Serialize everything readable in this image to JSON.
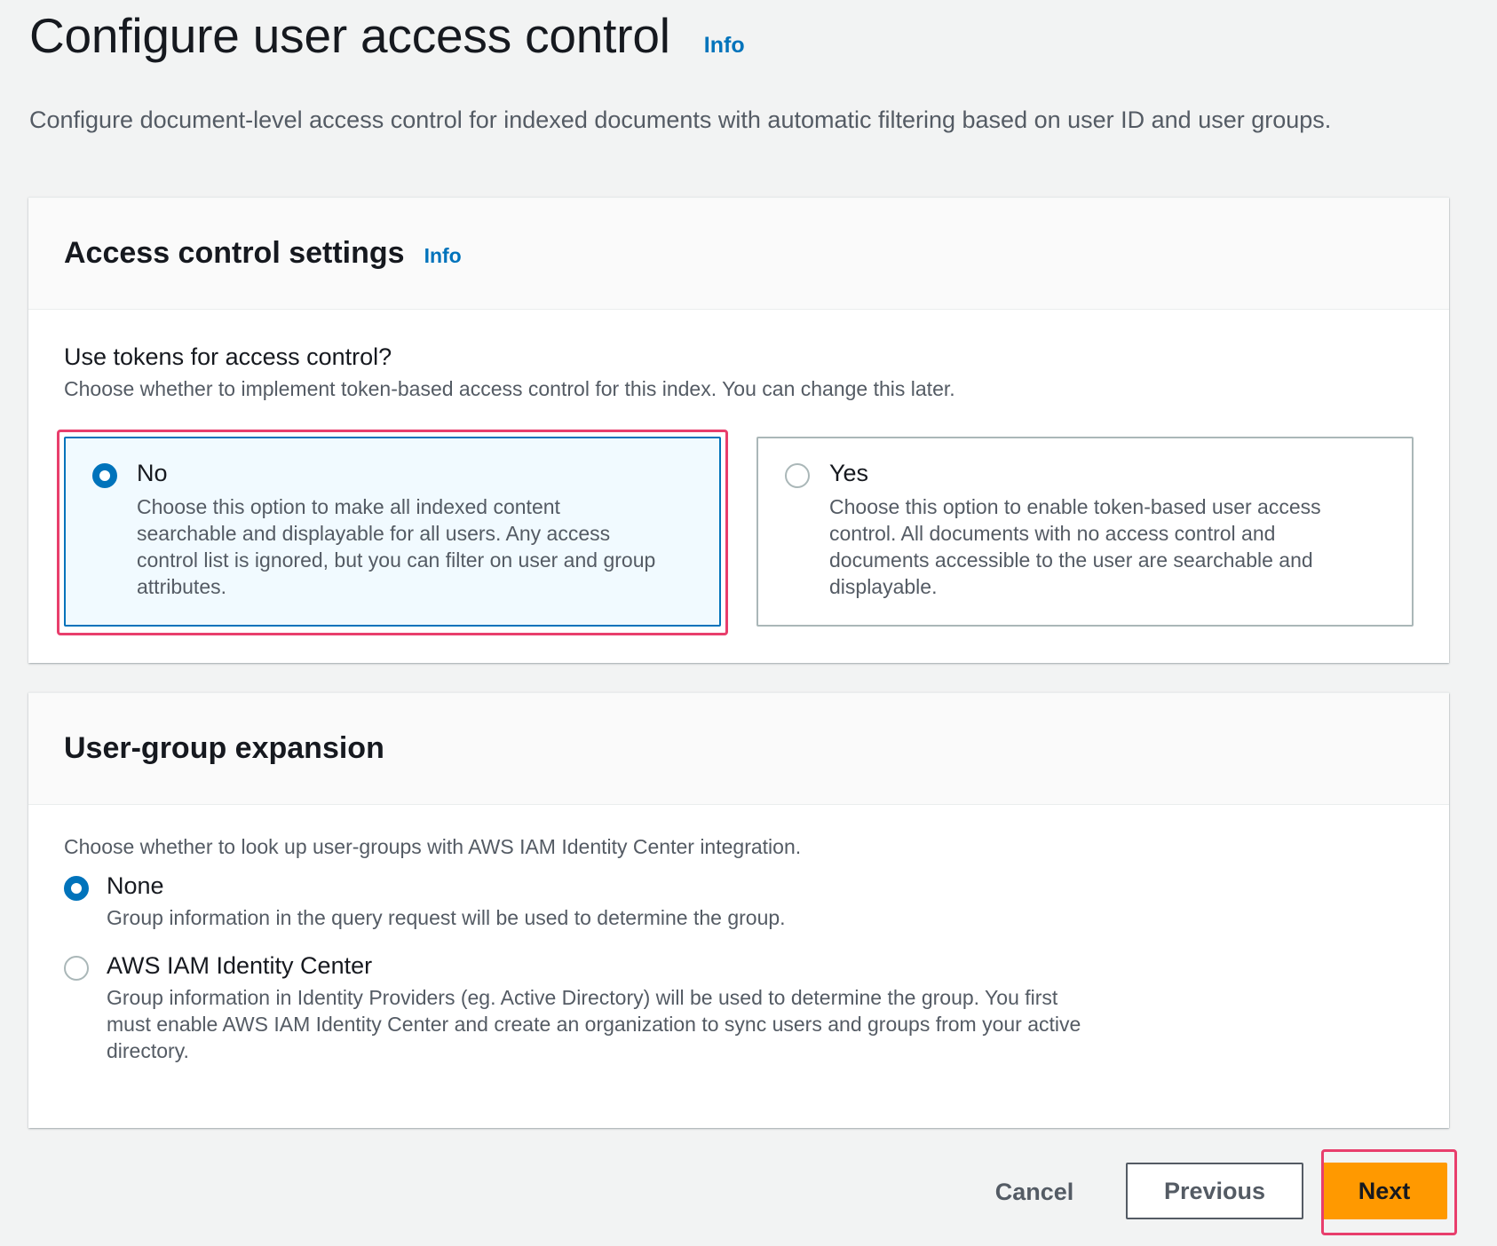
{
  "header": {
    "title": "Configure user access control",
    "info_label": "Info",
    "description": "Configure document-level access control for indexed documents with automatic filtering based on user ID and user groups."
  },
  "access_control": {
    "title": "Access control settings",
    "info_label": "Info",
    "field_label": "Use tokens for access control?",
    "field_description": "Choose whether to implement token-based access control for this index. You can change this later.",
    "selected": "no",
    "options": [
      {
        "id": "no",
        "label": "No",
        "description": "Choose this option to make all indexed content searchable and displayable for all users. Any access control list is ignored, but you can filter on user and group attributes."
      },
      {
        "id": "yes",
        "label": "Yes",
        "description": "Choose this option to enable token-based user access control. All documents with no access control and documents accessible to the user are searchable and displayable."
      }
    ]
  },
  "user_group_expansion": {
    "title": "User-group expansion",
    "description": "Choose whether to look up user-groups with AWS IAM Identity Center integration.",
    "selected": "none",
    "options": [
      {
        "id": "none",
        "label": "None",
        "description": "Group information in the query request will be used to determine the group."
      },
      {
        "id": "iam",
        "label": "AWS IAM Identity Center",
        "description": "Group information in Identity Providers (eg. Active Directory) will be used to determine the group. You first must enable AWS IAM Identity Center and create an organization to sync users and groups from your active directory."
      }
    ]
  },
  "actions": {
    "cancel": "Cancel",
    "previous": "Previous",
    "next": "Next"
  },
  "colors": {
    "background": "#f2f3f3",
    "link": "#0073bb",
    "selected_tile_bg": "#f1faff",
    "primary_button": "#ff9900",
    "highlight_annotation": "#e83e6c"
  }
}
